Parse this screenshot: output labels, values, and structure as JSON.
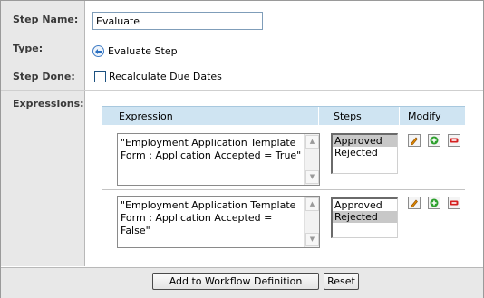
{
  "labels": {
    "step_name": "Step Name:",
    "type": "Type:",
    "step_done": "Step Done:",
    "expressions": "Expressions:"
  },
  "step_name_value": "Evaluate",
  "type_value": "Evaluate Step",
  "step_done_checkbox": {
    "label": "Recalculate Due Dates",
    "checked": false
  },
  "expressions_table": {
    "headers": {
      "expression": "Expression",
      "steps": "Steps",
      "modify": "Modify"
    },
    "rows": [
      {
        "expression": "\"Employment Application Template Form : Application Accepted = True\"",
        "steps": [
          {
            "label": "Approved",
            "selected": true
          },
          {
            "label": "Rejected",
            "selected": false
          }
        ]
      },
      {
        "expression": "\"Employment Application Template Form : Application Accepted = False\"",
        "steps": [
          {
            "label": "Approved",
            "selected": false
          },
          {
            "label": "Rejected",
            "selected": true
          }
        ]
      }
    ],
    "modify_icons": [
      "edit-icon",
      "add-icon",
      "delete-icon"
    ]
  },
  "buttons": {
    "add_to_workflow": "Add to Workflow Definition",
    "reset": "Reset"
  },
  "colors": {
    "label_bg": "#e8e8e8",
    "header_bg": "#cfe4f2",
    "selected_option": "#c8c8c8",
    "edit_orange": "#e08a00",
    "add_green": "#2ea02e",
    "delete_red": "#d42020"
  }
}
